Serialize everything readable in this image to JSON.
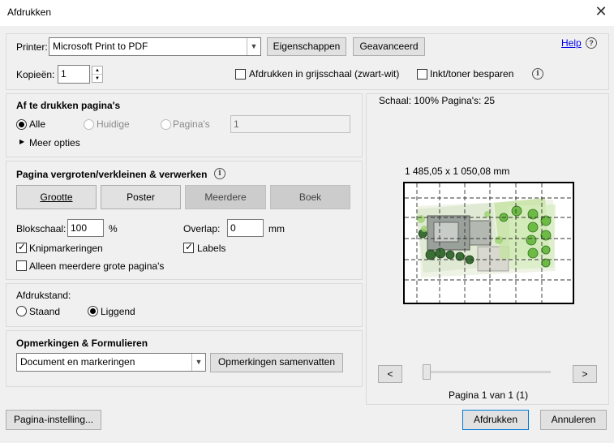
{
  "window": {
    "title": "Afdrukken",
    "close_label": "✕"
  },
  "printer": {
    "label": "Printer:",
    "selected": "Microsoft Print to PDF",
    "properties_button": "Eigenschappen",
    "advanced_button": "Geavanceerd",
    "help_link": "Help",
    "copies_label": "Kopieën:",
    "copies_value": "1",
    "grayscale_label": "Afdrukken in grijsschaal (zwart-wit)",
    "grayscale_checked": false,
    "save_ink_label": "Inkt/toner besparen",
    "save_ink_checked": false
  },
  "pages": {
    "heading": "Af te drukken pagina's",
    "all_label": "Alle",
    "current_label": "Huidige",
    "pages_label": "Pagina's",
    "pages_value": "1",
    "selected": "Alle",
    "more_options": "Meer opties"
  },
  "sizing": {
    "heading": "Pagina vergroten/verkleinen & verwerken",
    "tabs": [
      "Grootte",
      "Poster",
      "Meerdere",
      "Boek"
    ],
    "active_tab": "Poster",
    "tile_scale_label": "Blokschaal:",
    "tile_scale_value": "100",
    "tile_scale_unit": "%",
    "overlap_label": "Overlap:",
    "overlap_value": "0",
    "overlap_unit": "mm",
    "cut_marks_label": "Knipmarkeringen",
    "cut_marks_checked": true,
    "labels_label": "Labels",
    "labels_checked": true,
    "large_only_label": "Alleen meerdere grote pagina's",
    "large_only_checked": false
  },
  "orientation": {
    "heading": "Afdrukstand:",
    "portrait_label": "Staand",
    "landscape_label": "Liggend",
    "selected": "Liggend"
  },
  "comments": {
    "heading": "Opmerkingen & Formulieren",
    "selected": "Document en markeringen",
    "summarize_button": "Opmerkingen samenvatten"
  },
  "preview": {
    "scale_text": "Schaal: 100% Pagina's: 25",
    "dimensions": "1 485,05 x 1 050,08 mm",
    "prev_label": "<",
    "next_label": ">",
    "page_indicator": "Pagina 1 van 1 (1)"
  },
  "footer": {
    "page_setup_button": "Pagina-instelling...",
    "print_button": "Afdrukken",
    "cancel_button": "Annuleren"
  },
  "colors": {
    "accent_green": "#6dbb45",
    "dialog_bg": "#f0f0f0",
    "button_bg": "#e1e1e1"
  }
}
